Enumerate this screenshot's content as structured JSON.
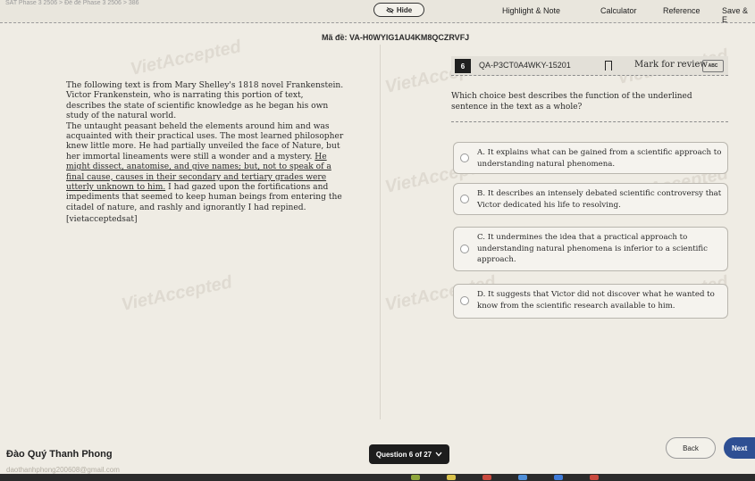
{
  "topbar": {
    "breadcrumb": "SAT Phase 3 2506 > Đề đề Phase 3 2506 > 386",
    "hide_label": "Hide",
    "tools": [
      "Highlight & Note",
      "Calculator",
      "Reference",
      "Save & E"
    ]
  },
  "exam_code": "Mã đề: VA-H0WYIG1AU4KM8QCZRVFJ",
  "passage": {
    "intro": "The following text is from Mary Shelley's 1818 novel Frankenstein. Victor Frankenstein, who is narrating this portion of text, describes the state of scientific knowledge as he began his own study of the natural world.",
    "body_plain_1": "The untaught peasant beheld the elements around him and was acquainted with their practical uses. The most learned philosopher knew little more. He had partially unveiled the face of Nature, but her immortal lineaments were still a wonder and a mystery. ",
    "body_underlined": "He might dissect, anatomise, and give names; but, not to speak of a final cause, causes in their secondary and tertiary grades were utterly unknown to him.",
    "body_plain_2": " I had gazed upon the fortifications and impediments that seemed to keep human beings from entering the citadel of nature, and rashly and ignorantly I had repined.",
    "tag": "[vietacceptedsat]"
  },
  "question": {
    "number": "6",
    "id": "QA-P3CT0A4WKY-15201",
    "mark_review": "Mark for review",
    "abc_label": "ABC",
    "stem": "Which choice best describes the function of the underlined sentence in the text as a whole?",
    "options": [
      {
        "text": "A. It explains what can be gained from a scientific approach to understanding natural phenomena."
      },
      {
        "text": "B. It describes an intensely debated scientific controversy that Victor dedicated his life to resolving."
      },
      {
        "text": "C. It undermines the idea that a practical approach to understanding natural phenomena is inferior to a scientific approach."
      },
      {
        "text": "D. It suggests that Victor did not discover what he wanted to know from the scientific research available to him."
      }
    ]
  },
  "footer": {
    "student_name": "Đào Quý Thanh Phong",
    "email": "daothanhphong200608@gmail.com",
    "question_nav": "Question 6 of 27",
    "back_label": "Back",
    "next_label": "Next"
  },
  "watermark": "VietAccepted",
  "colors": {
    "background": "#efece4",
    "next_button": "#2e4f93",
    "question_badge": "#1f1f1f"
  }
}
